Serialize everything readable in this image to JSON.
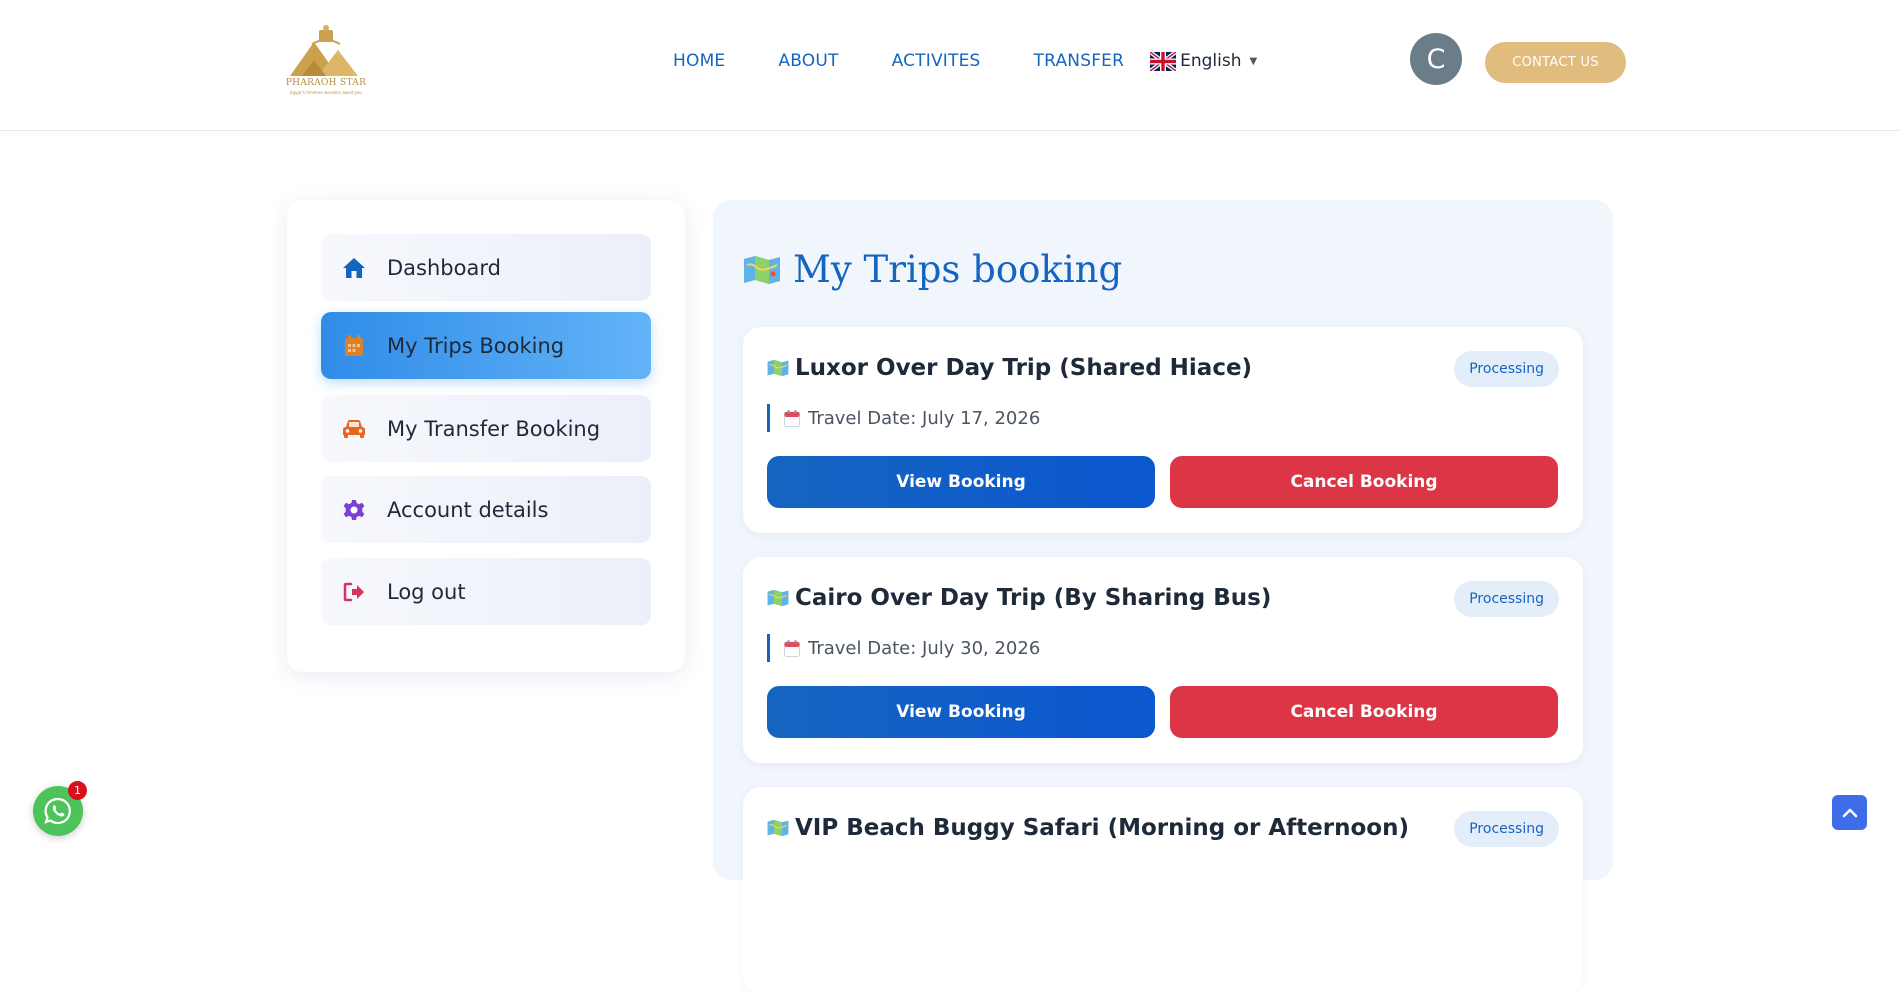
{
  "header": {
    "logo_text": "PHARAOH STAR",
    "logo_tagline": "Egypt's timeless wonders await you",
    "nav": [
      {
        "label": "HOME"
      },
      {
        "label": "ABOUT"
      },
      {
        "label": "ACTIVITES"
      },
      {
        "label": "TRANSFER"
      }
    ],
    "language": "English",
    "avatar_letter": "C",
    "contact_label": "CONTACT US"
  },
  "sidebar": {
    "items": [
      {
        "label": "Dashboard",
        "icon": "home-icon",
        "color": "#1565c0"
      },
      {
        "label": "My Trips Booking",
        "icon": "calendar-icon",
        "color": "#d9822b",
        "active": true
      },
      {
        "label": "My Transfer Booking",
        "icon": "car-icon",
        "color": "#e8651a"
      },
      {
        "label": "Account details",
        "icon": "gear-icon",
        "color": "#7e3fd6"
      },
      {
        "label": "Log out",
        "icon": "logout-icon",
        "color": "#d6335b"
      }
    ]
  },
  "main": {
    "title": "My Trips booking",
    "bookings": [
      {
        "title": "Luxor Over Day Trip (Shared Hiace)",
        "status": "Processing",
        "travel_date": "Travel Date: July 17, 2026",
        "view_label": "View Booking",
        "cancel_label": "Cancel Booking"
      },
      {
        "title": "Cairo Over Day Trip (By Sharing Bus)",
        "status": "Processing",
        "travel_date": "Travel Date: July 30, 2026",
        "view_label": "View Booking",
        "cancel_label": "Cancel Booking"
      },
      {
        "title": "VIP Beach Buggy Safari (Morning or Afternoon)",
        "status": "Processing"
      }
    ]
  },
  "whatsapp": {
    "badge": "1"
  },
  "colors": {
    "primary": "#1565c0",
    "danger": "#dc3545",
    "gold": "#e0bc7e",
    "active_gradient_start": "#2f8ce8",
    "active_gradient_end": "#63b3f7"
  }
}
